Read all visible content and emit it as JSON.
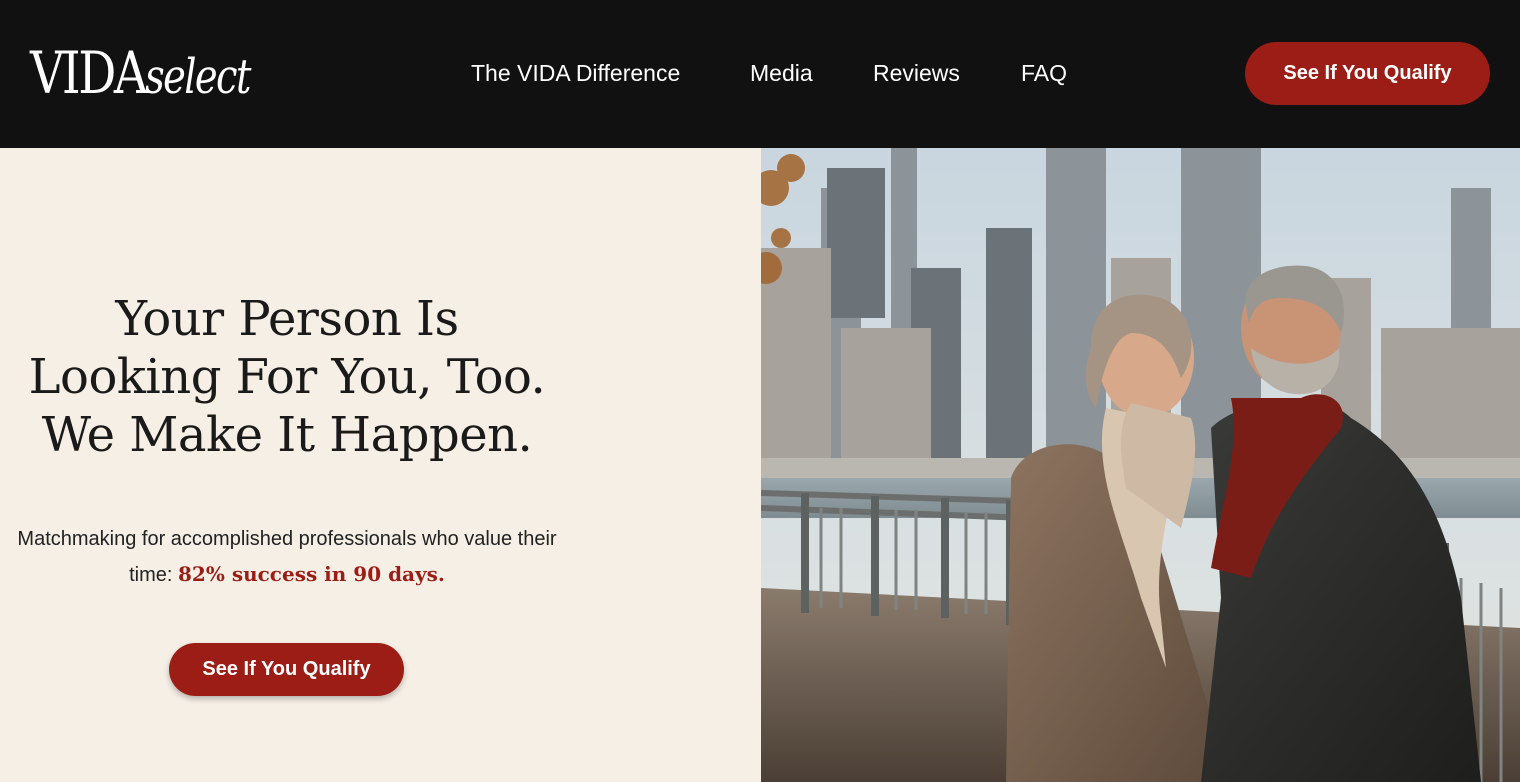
{
  "brand": {
    "logo_main": "VIDA",
    "logo_sub": "select"
  },
  "nav": {
    "items": [
      {
        "label": "The VIDA Difference"
      },
      {
        "label": "Media"
      },
      {
        "label": "Reviews"
      },
      {
        "label": "FAQ"
      }
    ],
    "cta_label": "See If You Qualify"
  },
  "hero": {
    "headline_lines": [
      "Your Person Is",
      "Looking For You, Too.",
      "We Make It Happen."
    ],
    "subtext_before": "Matchmaking for accomplished professionals who value their time: ",
    "subtext_highlight": "82% success in 90 days.",
    "cta_label": "See If You Qualify",
    "image_alt": "Smiling couple walking along a city waterfront in autumn"
  },
  "colors": {
    "header_bg": "#111111",
    "accent": "#9b1d15",
    "hero_bg": "#f5efe6"
  }
}
